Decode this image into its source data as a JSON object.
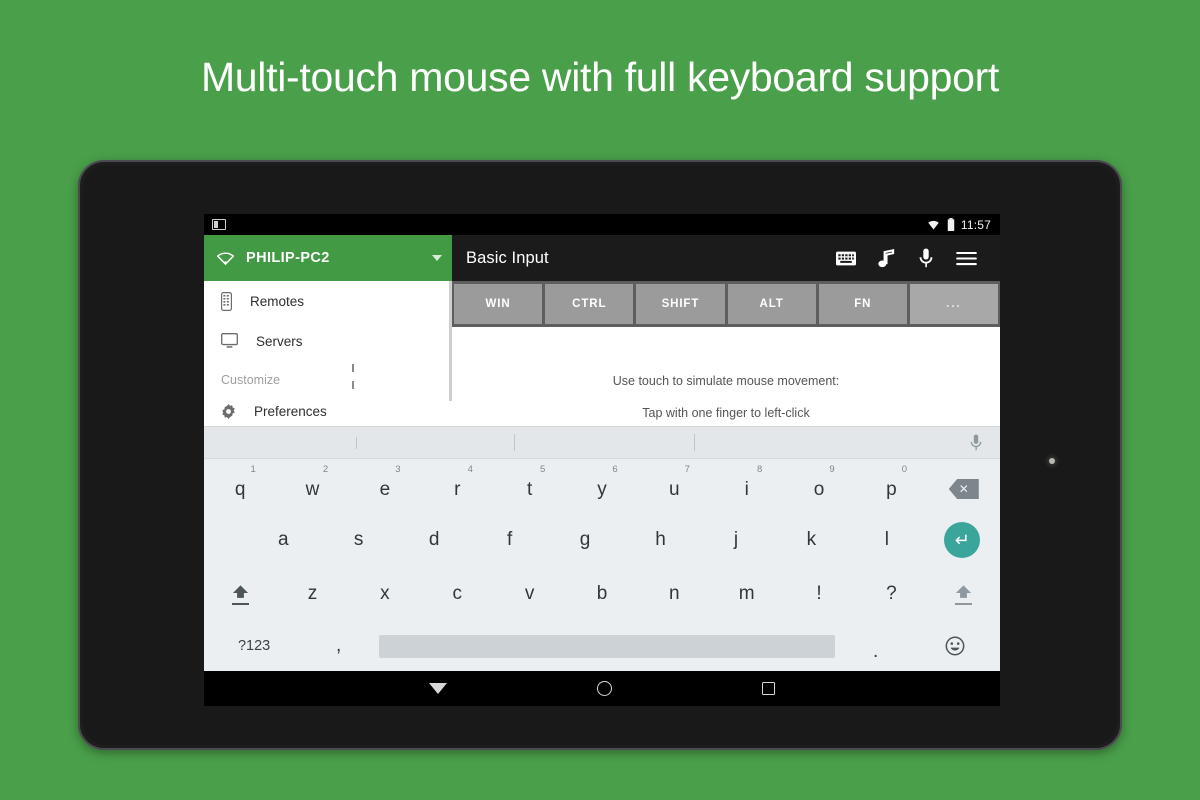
{
  "headline": "Multi-touch mouse with full keyboard support",
  "colors": {
    "background_green": "#4a9f4a",
    "appbar_green": "#429a44",
    "enter_key_teal": "#3aa69b",
    "modifier_key_gray": "#9b9b9b"
  },
  "status_bar": {
    "notification_icon": "notification-icon",
    "wifi_icon": "wifi-icon",
    "battery_icon": "battery-icon",
    "time": "11:57"
  },
  "appbar": {
    "connection_icon": "wifi-icon",
    "connection_name": "PHILIP-PC2",
    "dropdown_icon": "chevron-down-icon",
    "screen_title": "Basic Input",
    "actions": [
      {
        "name": "keyboard-icon",
        "label": "keyboard"
      },
      {
        "name": "music-note-icon",
        "label": "music"
      },
      {
        "name": "microphone-icon",
        "label": "microphone"
      },
      {
        "name": "menu-icon",
        "label": "menu"
      }
    ]
  },
  "drawer": {
    "items": [
      {
        "label": "Remotes",
        "icon": "remote-icon"
      },
      {
        "label": "Servers",
        "icon": "monitor-icon"
      }
    ],
    "section_label": "Customize",
    "preferences": {
      "label": "Preferences",
      "icon": "gear-icon"
    }
  },
  "modifier_keys": [
    "WIN",
    "CTRL",
    "SHIFT",
    "ALT",
    "FN",
    "..."
  ],
  "content": {
    "line1": "Use touch to simulate mouse movement:",
    "line2": "Tap with one finger to left-click"
  },
  "keyboard": {
    "suggestion_mic_icon": "microphone-icon",
    "row1": [
      {
        "key": "q",
        "num": "1"
      },
      {
        "key": "w",
        "num": "2"
      },
      {
        "key": "e",
        "num": "3"
      },
      {
        "key": "r",
        "num": "4"
      },
      {
        "key": "t",
        "num": "5"
      },
      {
        "key": "y",
        "num": "6"
      },
      {
        "key": "u",
        "num": "7"
      },
      {
        "key": "i",
        "num": "8"
      },
      {
        "key": "o",
        "num": "9"
      },
      {
        "key": "p",
        "num": "0"
      }
    ],
    "backspace_icon": "backspace-icon",
    "row2": [
      "a",
      "s",
      "d",
      "f",
      "g",
      "h",
      "j",
      "k",
      "l"
    ],
    "enter_icon": "enter-icon",
    "row3": [
      "z",
      "x",
      "c",
      "v",
      "b",
      "n",
      "m",
      "!",
      "?"
    ],
    "shift_icon": "shift-icon",
    "row4": {
      "symbols_key": "?123",
      "comma": ",",
      "space": "",
      "period": ".",
      "emoji_icon": "emoji-icon"
    }
  },
  "navbar": {
    "back": "back-icon",
    "home": "home-icon",
    "recents": "recents-icon"
  }
}
